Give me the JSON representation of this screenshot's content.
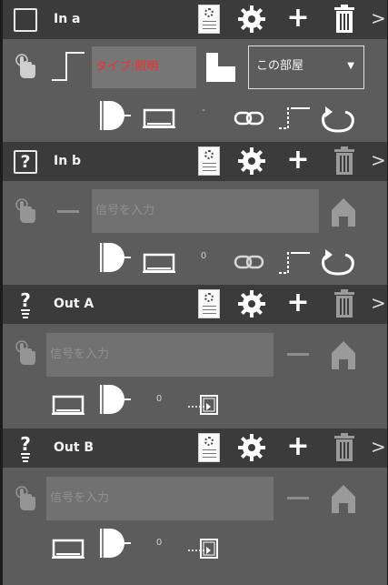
{
  "blocks": [
    {
      "key": "in_a",
      "title": "In a",
      "box_icon": "empty-square",
      "type_label": "タイプ:照明",
      "scope_select": "この部屋",
      "bottom_value": "-"
    },
    {
      "key": "in_b",
      "title": "In b",
      "box_icon": "question-square",
      "signal_placeholder": "信号を入力",
      "bottom_value": "0"
    },
    {
      "key": "out_a",
      "title": "Out A",
      "box_icon": "lightbulb-question",
      "signal_placeholder": "信号を入力",
      "bottom_value": "0"
    },
    {
      "key": "out_b",
      "title": "Out B",
      "box_icon": "lightbulb-question",
      "signal_placeholder": "信号を入力",
      "bottom_value": "0"
    }
  ],
  "colors": {
    "panel_bg": "#5c5c5c",
    "header_bg": "#3b3b3b",
    "input_bg": "#717171",
    "type_label": "#ff2a2a"
  },
  "icons": [
    "touch-hand-icon",
    "step-pulse-icon",
    "room-corner-icon",
    "and-gate-icon",
    "device-box-icon",
    "chain-link-icon",
    "delay-step-icon",
    "loop-arrow-icon",
    "minus-icon",
    "home-icon",
    "input-arrow-box-icon",
    "document-settings-icon",
    "gear-icon",
    "plus-icon",
    "trash-icon",
    "chevron-right-icon"
  ]
}
